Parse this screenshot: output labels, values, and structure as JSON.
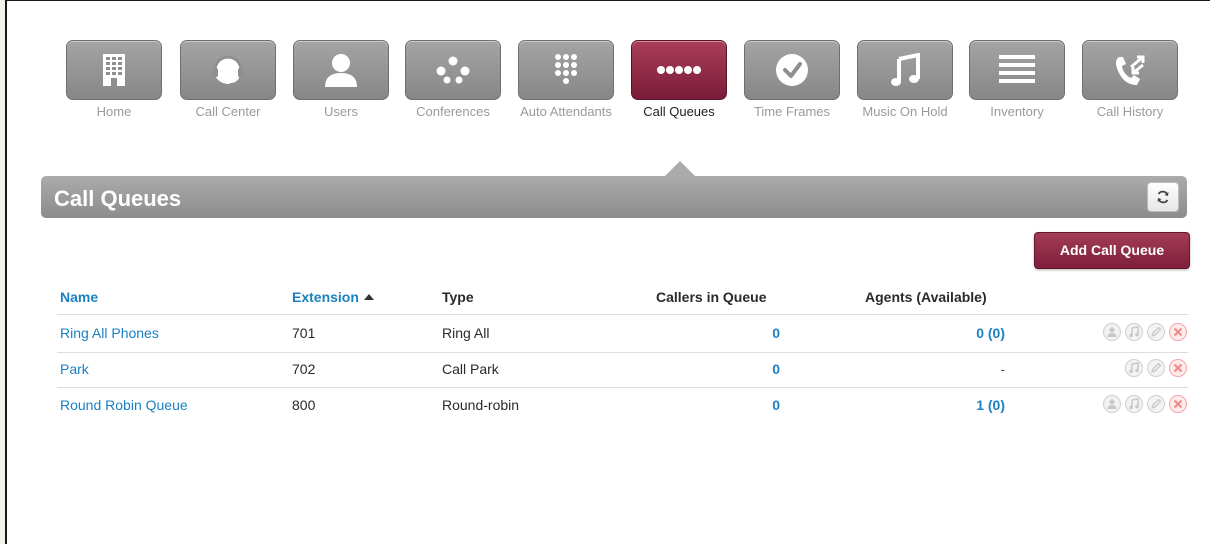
{
  "nav": {
    "items": [
      {
        "label": "Home",
        "icon": "building-icon",
        "active": false
      },
      {
        "label": "Call Center",
        "icon": "headset-icon",
        "active": false
      },
      {
        "label": "Users",
        "icon": "user-icon",
        "active": false
      },
      {
        "label": "Conferences",
        "icon": "conference-dots-icon",
        "active": false
      },
      {
        "label": "Auto Attendants",
        "icon": "keypad-icon",
        "active": false
      },
      {
        "label": "Call Queues",
        "icon": "queue-dots-icon",
        "active": true
      },
      {
        "label": "Time Frames",
        "icon": "clock-icon",
        "active": false
      },
      {
        "label": "Music On Hold",
        "icon": "music-note-icon",
        "active": false
      },
      {
        "label": "Inventory",
        "icon": "list-lines-icon",
        "active": false
      },
      {
        "label": "Call History",
        "icon": "phone-arrows-icon",
        "active": false
      }
    ]
  },
  "section": {
    "title": "Call Queues",
    "refresh_icon": "refresh-icon",
    "add_button": "Add Call Queue"
  },
  "table": {
    "headers": {
      "name": "Name",
      "extension": "Extension",
      "type": "Type",
      "callers": "Callers in Queue",
      "agents": "Agents (Available)"
    },
    "sort": {
      "column": "extension",
      "direction": "ascending"
    },
    "rows": [
      {
        "name": "Ring All Phones",
        "extension": "701",
        "type": "Ring All",
        "callers": "0",
        "agents": "0 (0)",
        "actions": [
          "agents-icon",
          "music-icon",
          "edit-icon",
          "delete-icon"
        ]
      },
      {
        "name": "Park",
        "extension": "702",
        "type": "Call Park",
        "callers": "0",
        "agents": "-",
        "actions": [
          "music-icon",
          "edit-icon",
          "delete-icon"
        ]
      },
      {
        "name": "Round Robin Queue",
        "extension": "800",
        "type": "Round-robin",
        "callers": "0",
        "agents": "1 (0)",
        "actions": [
          "agents-icon",
          "music-icon",
          "edit-icon",
          "delete-icon"
        ]
      }
    ]
  },
  "colors": {
    "accent": "#8f2a48",
    "link": "#1a82c3",
    "tile_gray": "#959595",
    "header_bar": "#9c9c9c",
    "delete": "#f08a8a"
  }
}
